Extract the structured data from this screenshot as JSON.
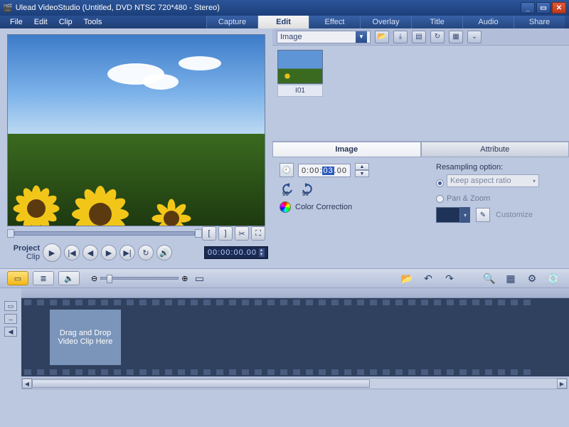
{
  "titlebar": {
    "title": "Ulead VideoStudio (Untitled, DVD NTSC 720*480 - Stereo)"
  },
  "menus": {
    "file": "File",
    "edit": "Edit",
    "clip": "Clip",
    "tools": "Tools"
  },
  "tabs": {
    "capture": "Capture",
    "edit": "Edit",
    "effect": "Effect",
    "overlay": "Overlay",
    "title": "Title",
    "audio": "Audio",
    "share": "Share"
  },
  "transport": {
    "project": "Project",
    "clip": "Clip",
    "timecode": "00:00:00.00"
  },
  "library": {
    "selector": "Image",
    "thumb1": "I01"
  },
  "proptabs": {
    "image": "Image",
    "attribute": "Attribute"
  },
  "props": {
    "duration": "0:00:",
    "duration_hl": "03",
    "duration_suffix": ".00",
    "rot90a": "90",
    "rot90b": "90",
    "colorcorr": "Color Correction",
    "resample_label": "Resampling option:",
    "keep_aspect": "Keep aspect ratio",
    "pan_zoom": "Pan & Zoom",
    "customize": "Customize"
  },
  "timeline": {
    "clip_placeholder": "Drag and Drop Video Clip Here"
  }
}
